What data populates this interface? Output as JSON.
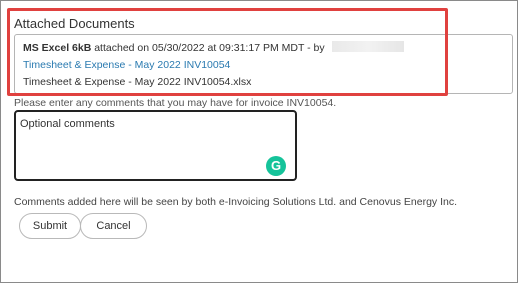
{
  "attachments": {
    "title": "Attached Documents",
    "meta": {
      "file_info": "MS Excel 6kB",
      "attached_text": "attached on 05/30/2022 at 09:31:17 PM MDT - by"
    },
    "link_label": "Timesheet & Expense - May 2022 INV10054",
    "file_name": "Timesheet & Expense - May 2022 INV10054.xlsx"
  },
  "comments": {
    "prompt": "Please enter any comments that you may have for invoice INV10054.",
    "placeholder": "Optional comments",
    "grammarly_glyph": "G",
    "info": "Comments added here will be seen by both e-Invoicing Solutions Ltd. and Cenovus Energy Inc."
  },
  "actions": {
    "submit_label": "Submit",
    "cancel_label": "Cancel"
  },
  "colors": {
    "highlight": "#e0413f",
    "link": "#2a7ab0",
    "grammarly": "#15c39a"
  }
}
